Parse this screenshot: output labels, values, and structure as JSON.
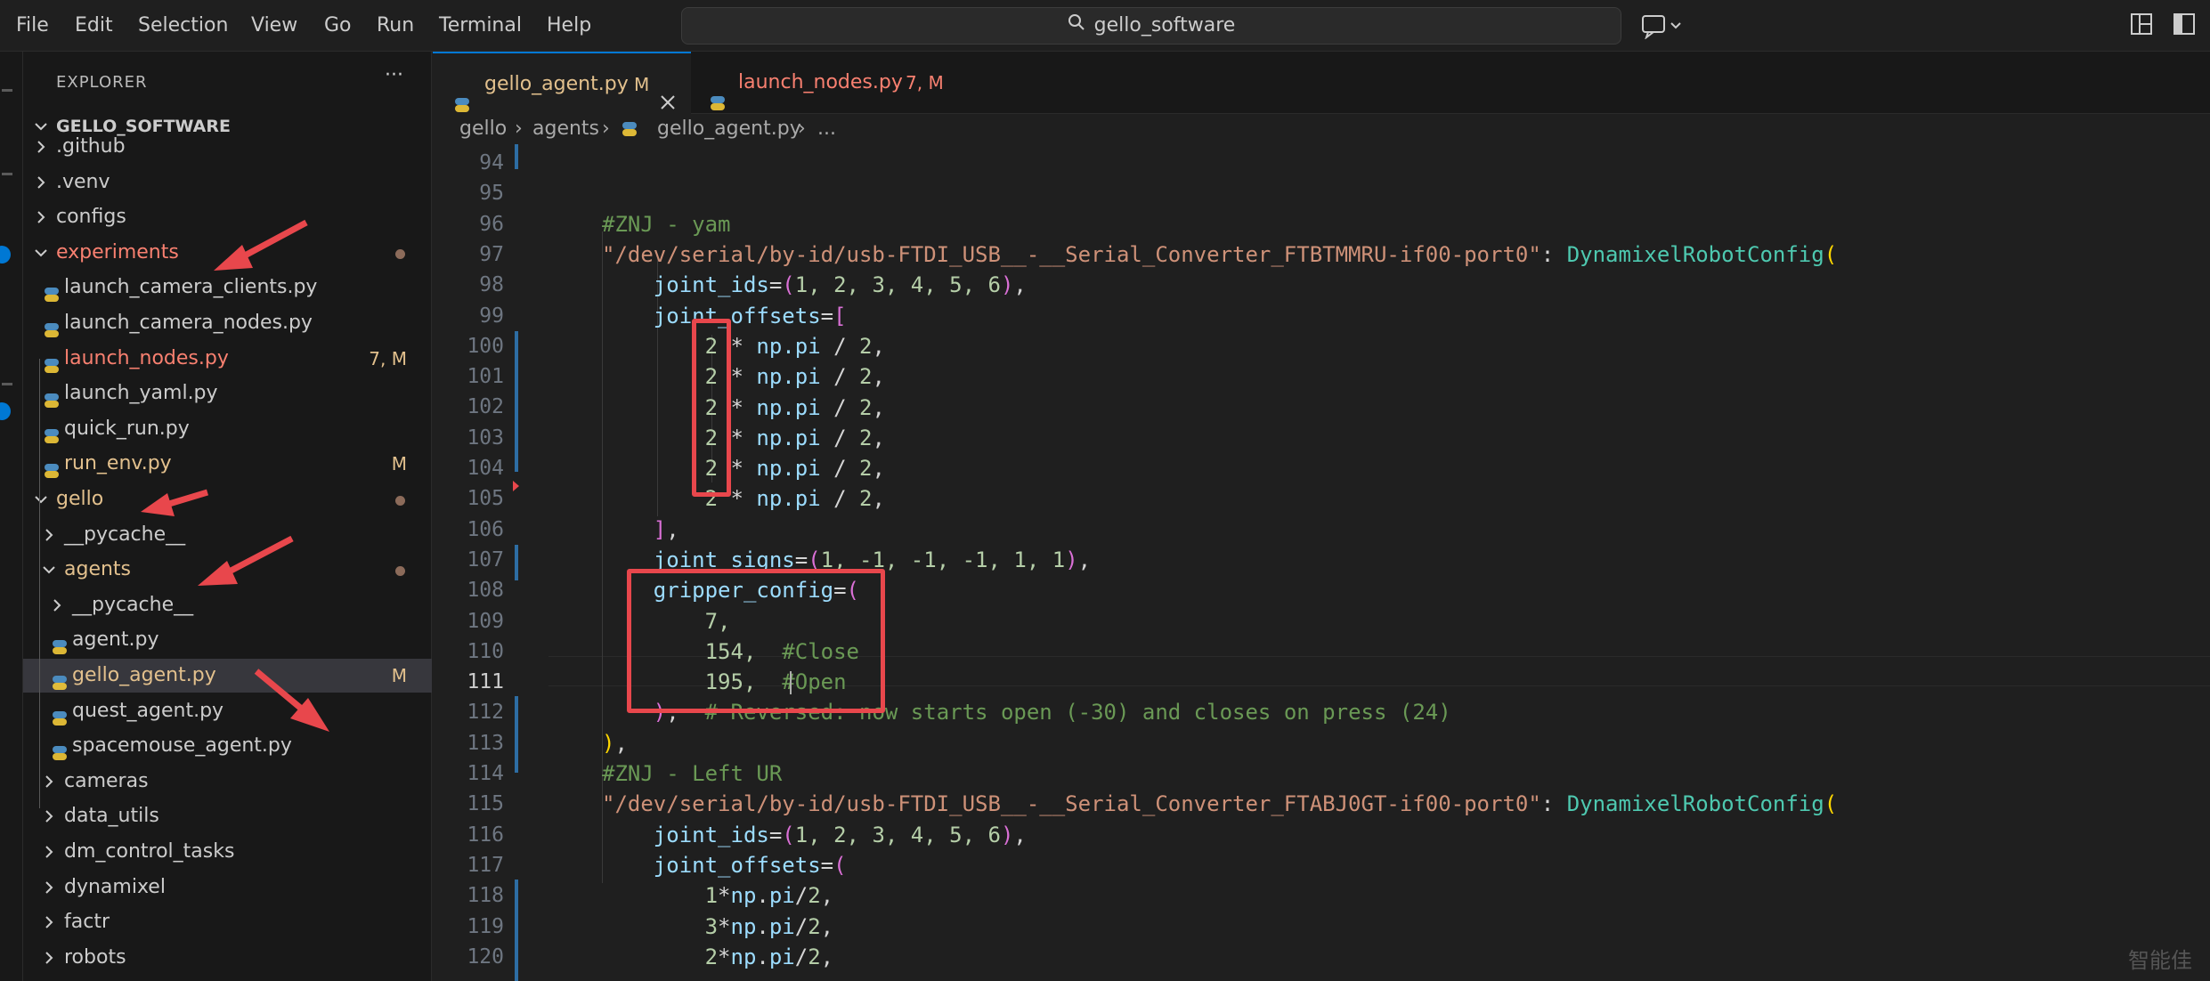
{
  "menu": [
    "File",
    "Edit",
    "Selection",
    "View",
    "Go",
    "Run",
    "Terminal",
    "Help"
  ],
  "search": {
    "text": "gello_software"
  },
  "explorer": {
    "title": "EXPLORER",
    "more": "···",
    "root": "GELLO_SOFTWARE",
    "items": [
      {
        "label": ".github",
        "type": "folder",
        "expanded": false
      },
      {
        "label": ".venv",
        "type": "folder",
        "expanded": false
      },
      {
        "label": "configs",
        "type": "folder",
        "expanded": false
      },
      {
        "label": "experiments",
        "type": "folder",
        "expanded": true,
        "status": "error"
      },
      {
        "label": "launch_camera_clients.py",
        "type": "file"
      },
      {
        "label": "launch_camera_nodes.py",
        "type": "file"
      },
      {
        "label": "launch_nodes.py",
        "type": "file",
        "badge": "7, M",
        "status": "error"
      },
      {
        "label": "launch_yaml.py",
        "type": "file"
      },
      {
        "label": "quick_run.py",
        "type": "file"
      },
      {
        "label": "run_env.py",
        "type": "file",
        "badge": "M",
        "status": "modified"
      },
      {
        "label": "gello",
        "type": "folder",
        "expanded": true,
        "status": "modified"
      },
      {
        "label": "__pycache__",
        "type": "folder",
        "expanded": false
      },
      {
        "label": "agents",
        "type": "folder",
        "expanded": true,
        "status": "modified"
      },
      {
        "label": "__pycache__",
        "type": "folder",
        "expanded": false
      },
      {
        "label": "agent.py",
        "type": "file"
      },
      {
        "label": "gello_agent.py",
        "type": "file",
        "badge": "M",
        "status": "modified",
        "selected": true
      },
      {
        "label": "quest_agent.py",
        "type": "file"
      },
      {
        "label": "spacemouse_agent.py",
        "type": "file"
      },
      {
        "label": "cameras",
        "type": "folder",
        "expanded": false
      },
      {
        "label": "data_utils",
        "type": "folder",
        "expanded": false
      },
      {
        "label": "dm_control_tasks",
        "type": "folder",
        "expanded": false
      },
      {
        "label": "dynamixel",
        "type": "folder",
        "expanded": false
      },
      {
        "label": "factr",
        "type": "folder",
        "expanded": false
      },
      {
        "label": "robots",
        "type": "folder",
        "expanded": false
      }
    ]
  },
  "tabs": [
    {
      "label": "gello_agent.py",
      "badge": "M",
      "active": true
    },
    {
      "label": "launch_nodes.py",
      "badge": "7, M",
      "active": false
    }
  ],
  "breadcrumb": [
    "gello",
    "agents",
    "gello_agent.py",
    "..."
  ],
  "editor": {
    "line_numbers": [
      "94",
      "95",
      "96",
      "97",
      "98",
      "99",
      "100",
      "101",
      "102",
      "103",
      "104",
      "105",
      "106",
      "107",
      "108",
      "109",
      "110",
      "111",
      "112",
      "113",
      "114",
      "115",
      "116",
      "117",
      "118",
      "119",
      "120"
    ],
    "current_line": "111"
  },
  "code": {
    "l96": "#ZNJ - yam",
    "l97_str": "\"/dev/serial/by-id/usb-FTDI_USB__-__Serial_Converter_FTBTMMRU-if00-port0\"",
    "l97_cls": "DynamixelRobotConfig",
    "joint_ids": "joint_ids",
    "joint_offsets": "joint_offsets",
    "joint_signs": "joint_signs",
    "gripper_config": "gripper_config",
    "np_pi": "np.pi",
    "l98_vals": "1, 2, 3, 4, 5, 6",
    "l107_vals": "1, -1, -1, -1, 1, 1",
    "offset_mult": "2",
    "offset_div": "2",
    "l109_val": "7,",
    "l110_val": "154,",
    "l110_comment": "#Close",
    "l111_val": "195,",
    "l111_comment": "#Open",
    "l112_comment": "# Reversed: now starts open (-30) and closes on press (24)",
    "l114": "#ZNJ - Left UR",
    "l115_str": "\"/dev/serial/by-id/usb-FTDI_USB__-__Serial_Converter_FTABJ0GT-if00-port0\"",
    "l115_cls": "DynamixelRobotConfig",
    "l118_coef": "1",
    "l119_coef": "3",
    "l120_coef": "2",
    "np": "np",
    "pi": "pi"
  },
  "watermark": "智能佳",
  "colors": {
    "accent": "#0078d4",
    "annotation": "#e8474c",
    "modified": "#e2c08d",
    "error": "#f88070"
  }
}
